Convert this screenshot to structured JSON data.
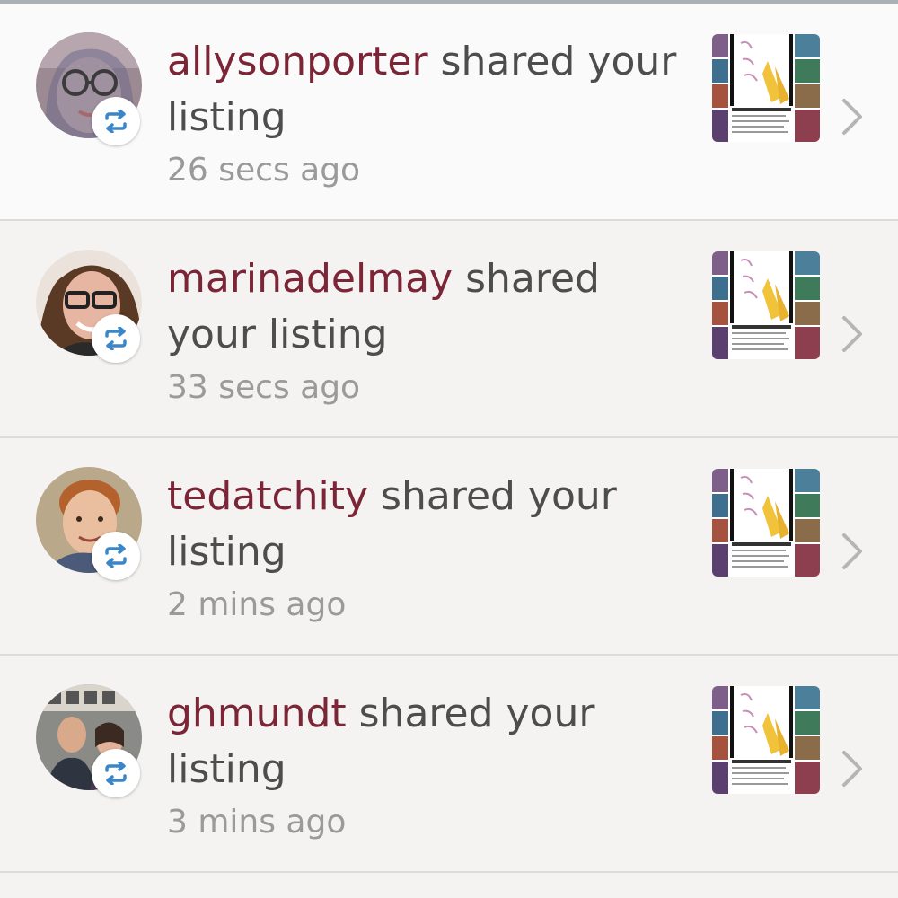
{
  "notifications": [
    {
      "username": "allysonporter",
      "message": " shared your listing",
      "time": "26 secs ago",
      "avatar_icon": "user-avatar-woman-glasses",
      "badge_icon": "share-repost-icon"
    },
    {
      "username": "marinadelmay",
      "message": " shared your listing",
      "time": "33 secs ago",
      "avatar_icon": "user-avatar-woman-smiling",
      "badge_icon": "share-repost-icon"
    },
    {
      "username": "tedatchity",
      "message": " shared your listing",
      "time": "2 mins ago",
      "avatar_icon": "user-avatar-boy-photo",
      "badge_icon": "share-repost-icon"
    },
    {
      "username": "ghmundt",
      "message": " shared your listing",
      "time": "3 mins ago",
      "avatar_icon": "user-avatar-couple-photo",
      "badge_icon": "share-repost-icon"
    }
  ],
  "colors": {
    "username": "#7b2536",
    "message": "#4d4d4d",
    "time": "#9a9a9a",
    "share_icon": "#3b86c8",
    "chevron": "#b5b5b5",
    "divider": "#dcdbd9"
  }
}
